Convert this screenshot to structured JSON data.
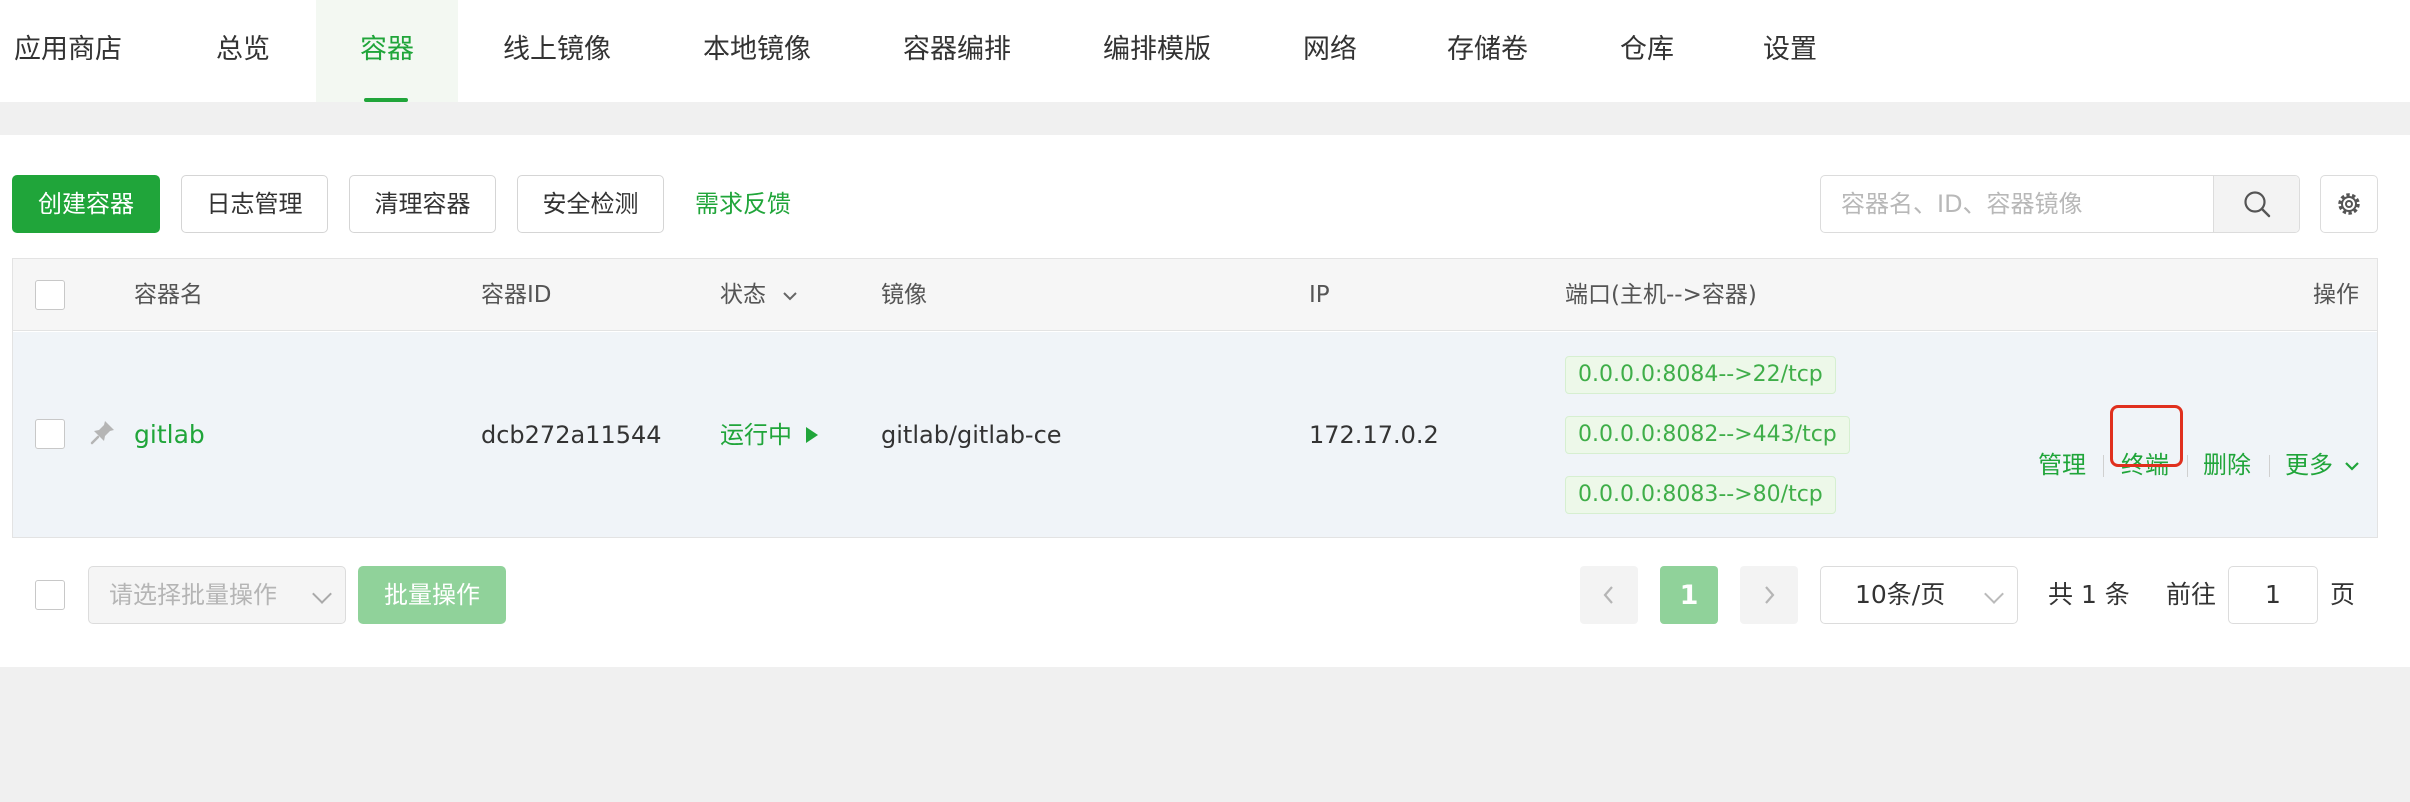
{
  "tabs": [
    "应用商店",
    "总览",
    "容器",
    "线上镜像",
    "本地镜像",
    "容器编排",
    "编排模版",
    "网络",
    "存储卷",
    "仓库",
    "设置"
  ],
  "toolbar": {
    "create": "创建容器",
    "logs": "日志管理",
    "clean": "清理容器",
    "security": "安全检测",
    "feedback": "需求反馈"
  },
  "search": {
    "placeholder": "容器名、ID、容器镜像"
  },
  "columns": {
    "name": "容器名",
    "id": "容器ID",
    "status": "状态",
    "image": "镜像",
    "ip": "IP",
    "ports": "端口(主机-->容器)",
    "actions": "操作"
  },
  "row": {
    "name": "gitlab",
    "id": "dcb272a11544",
    "status": "运行中",
    "image": "gitlab/gitlab-ce",
    "ip": "172.17.0.2",
    "ports": [
      "0.0.0.0:8084-->22/tcp",
      "0.0.0.0:8082-->443/tcp",
      "0.0.0.0:8083-->80/tcp"
    ],
    "actions": {
      "manage": "管理",
      "terminal": "终端",
      "delete": "删除",
      "more": "更多"
    }
  },
  "footer": {
    "batch_placeholder": "请选择批量操作",
    "batch_button": "批量操作",
    "current_page": "1",
    "page_size": "10条/页",
    "total": "共 1 条",
    "goto_prefix": "前往",
    "goto_value": "1",
    "goto_suffix": "页"
  },
  "colors": {
    "accent": "#20a53a",
    "highlight": "#e0301e"
  },
  "icons": [
    "search-icon",
    "gear-icon",
    "pin-icon",
    "play-icon",
    "chevron-down-icon",
    "chevron-left-icon",
    "chevron-right-icon"
  ]
}
